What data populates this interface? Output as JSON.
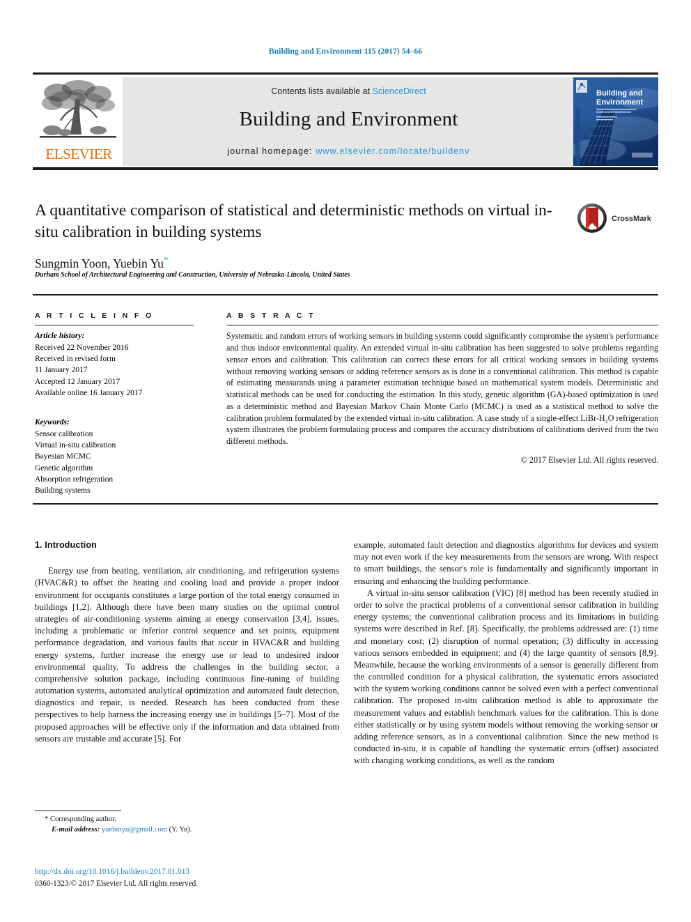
{
  "running_head": "Building and Environment 115 (2017) 54–66",
  "masthead": {
    "publisher_name": "ELSEVIER",
    "contents_prefix": "Contents lists available at ",
    "contents_link": "ScienceDirect",
    "journal_title": "Building and Environment",
    "homepage_prefix": "journal homepage: ",
    "homepage_url": "www.elsevier.com/locate/buildenv",
    "cover_title_line1": "Building and",
    "cover_title_line2": "Environment"
  },
  "title_block": {
    "title": "A quantitative comparison of statistical and deterministic methods on virtual in-situ calibration in building systems",
    "authors": "Sungmin Yoon, Yuebin Yu",
    "corresponding_marker": "*",
    "affiliation": "Durham School of Architectural Engineering and Construction, University of Nebraska-Lincoln, United States",
    "crossmark_label": "CrossMark"
  },
  "article_info": {
    "heading": "A R T I C L E    I N F O",
    "history_label": "Article history:",
    "history_lines": [
      "Received 22 November 2016",
      "Received in revised form",
      "11 January 2017",
      "Accepted 12 January 2017",
      "Available online 16 January 2017"
    ],
    "keywords_label": "Keywords:",
    "keywords": [
      "Sensor calibration",
      "Virtual in-situ calibration",
      "Bayesian MCMC",
      "Genetic algorithm",
      "Absorption refrigeration",
      "Building systems"
    ]
  },
  "abstract": {
    "heading": "A B S T R A C T",
    "text": "Systematic and random errors of working sensors in building systems could significantly compromise the system's performance and thus indoor environmental quality. An extended virtual in-situ calibration has been suggested to solve problems regarding sensor errors and calibration. This calibration can correct these errors for all critical working sensors in building systems without removing working sensors or adding reference sensors as is done in a conventional calibration. This method is capable of estimating measurands using a parameter estimation technique based on mathematical system models. Deterministic and statistical methods can be used for conducting the estimation. In this study, genetic algorithm (GA)-based optimization is used as a deterministic method and Bayesian Markov Chain Monte Carlo (MCMC) is used as a statistical method to solve the calibration problem formulated by the extended virtual in-situ calibration. A case study of a single-effect LiBr-H₂O refrigeration system illustrates the problem formulating process and compares the accuracy distributions of calibrations derived from the two different methods.",
    "copyright": "© 2017 Elsevier Ltd. All rights reserved."
  },
  "body": {
    "section_heading": "1. Introduction",
    "left_paragraph_1": "Energy use from heating, ventilation, air conditioning, and refrigeration systems (HVAC&R) to offset the heating and cooling load and provide a proper indoor environment for occupants constitutes a large portion of the total energy consumed in buildings [1,2]. Although there have been many studies on the optimal control strategies of air-conditioning systems aiming at energy conservation [3,4], issues, including a problematic or inferior control sequence and set points, equipment performance degradation, and various faults that occur in HVAC&R and building energy systems, further increase the energy use or lead to undesired indoor environmental quality. To address the challenges in the building sector, a comprehensive solution package, including continuous fine-tuning of building automation systems, automated analytical optimization and automated fault detection, diagnostics and repair, is needed. Research has been conducted from these perspectives to help harness the increasing energy use in buildings [5–7]. Most of the proposed approaches will be effective only if the information and data obtained from sensors are trustable and accurate [5]. For",
    "right_paragraph_1": "example, automated fault detection and diagnostics algorithms for devices and system may not even work if the key measurements from the sensors are wrong. With respect to smart buildings, the sensor's role is fundamentally and significantly important in ensuring and enhancing the building performance.",
    "right_paragraph_2": "A virtual in-situ sensor calibration (VIC) [8] method has been recently studied in order to solve the practical problems of a conventional sensor calibration in building energy systems; the conventional calibration process and its limitations in building systems were described in Ref. [8]. Specifically, the problems addressed are: (1) time and monetary cost; (2) disruption of normal operation; (3) difficulty in accessing various sensors embedded in equipment; and (4) the large quantity of sensors [8,9]. Meanwhile, because the working environments of a sensor is generally different from the controlled condition for a physical calibration, the systematic errors associated with the system working conditions cannot be solved even with a perfect conventional calibration. The proposed in-situ calibration method is able to approximate the measurement values and establish benchmark values for the calibration. This is done either statistically or by using system models without removing the working sensor or adding reference sensors, as in a conventional calibration. Since the new method is conducted in-situ, it is capable of handling the systematic errors (offset) associated with changing working conditions, as well as the random"
  },
  "footnote": {
    "corresponding_author": "* Corresponding author.",
    "email_label": "E-mail address:",
    "email": "yuebinyu@gmail.com",
    "email_suffix": "(Y. Yu)."
  },
  "footer": {
    "doi": "http://dx.doi.org/10.1016/j.buildenv.2017.01.013",
    "issn_line": "0360-1323/© 2017 Elsevier Ltd. All rights reserved."
  },
  "colors": {
    "link_blue": "#1a7bb5",
    "science_direct_blue": "#2a95d5",
    "elsevier_orange": "#eb6d09",
    "crossmark_red": "#b42018",
    "cover_blue": "#0b2f66"
  }
}
